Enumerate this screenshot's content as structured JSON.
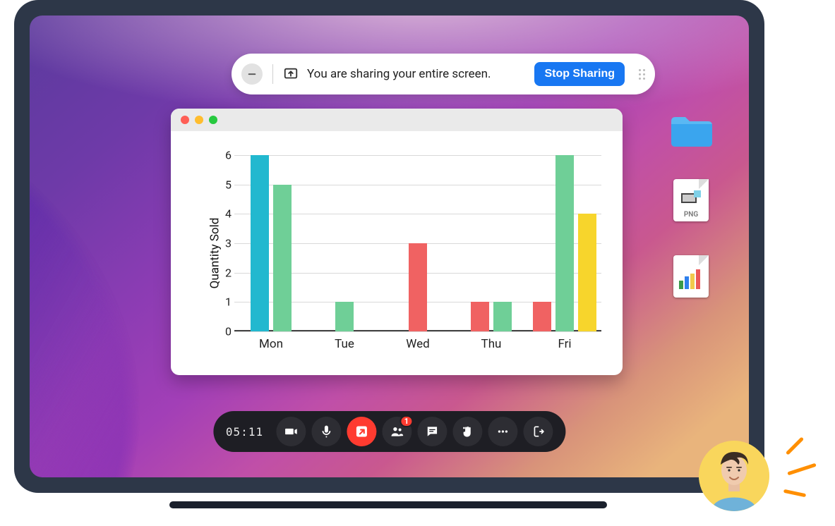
{
  "share_banner": {
    "message": "You are sharing your entire screen.",
    "stop_label": "Stop Sharing"
  },
  "meeting_bar": {
    "timer": "05:11",
    "participants_badge": "1"
  },
  "desktop": {
    "png_label": "PNG"
  },
  "chart_data": {
    "type": "bar",
    "ylabel": "Quantity Sold",
    "ylim": [
      0,
      6
    ],
    "yticks": [
      0,
      1,
      2,
      3,
      4,
      5,
      6
    ],
    "categories": [
      "Mon",
      "Tue",
      "Wed",
      "Thu",
      "Fri"
    ],
    "series_colors": [
      "#22b8cf",
      "#f06262",
      "#6fcf97",
      "#f7d52c"
    ],
    "groups": [
      {
        "category": "Mon",
        "bars": [
          {
            "series": 0,
            "value": 6
          },
          {
            "series": 2,
            "value": 5
          }
        ]
      },
      {
        "category": "Tue",
        "bars": [
          {
            "series": 2,
            "value": 1
          }
        ]
      },
      {
        "category": "Wed",
        "bars": [
          {
            "series": 1,
            "value": 3
          }
        ]
      },
      {
        "category": "Thu",
        "bars": [
          {
            "series": 1,
            "value": 1
          },
          {
            "series": 2,
            "value": 1
          }
        ]
      },
      {
        "category": "Fri",
        "bars": [
          {
            "series": 1,
            "value": 1
          },
          {
            "series": 2,
            "value": 6
          },
          {
            "series": 3,
            "value": 4
          }
        ]
      }
    ]
  }
}
